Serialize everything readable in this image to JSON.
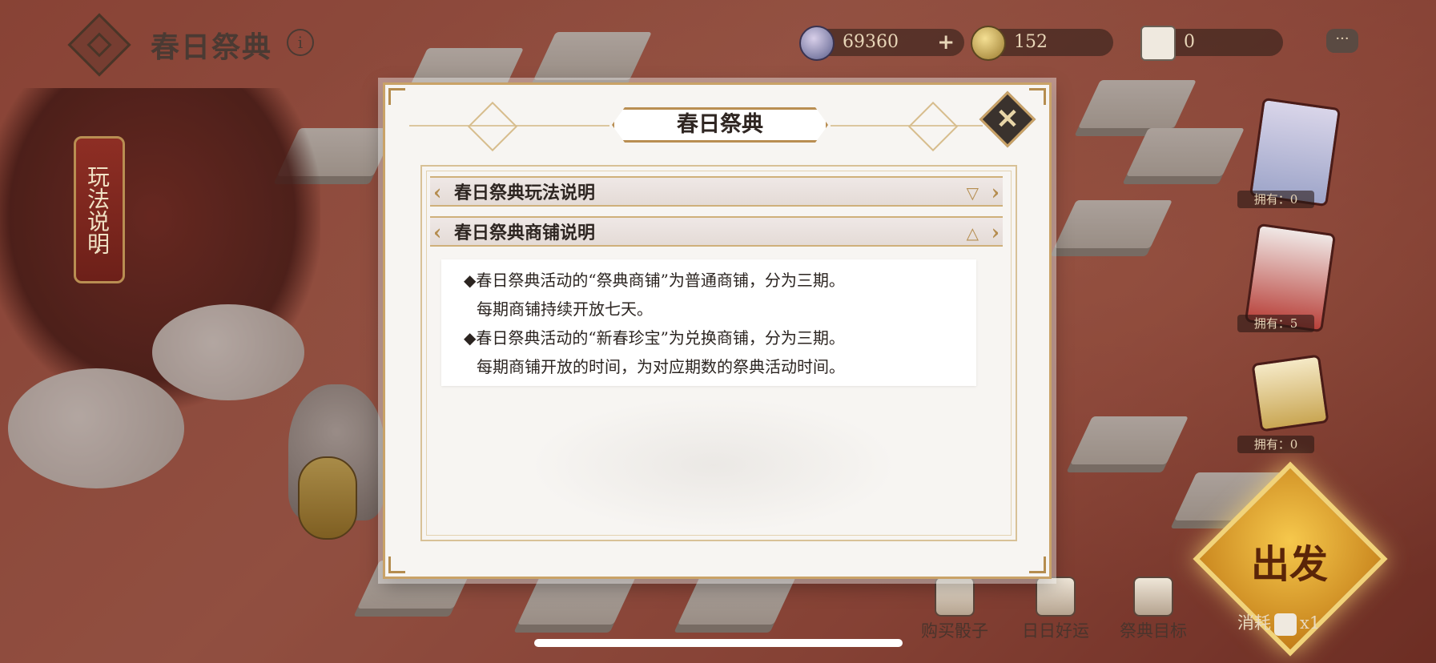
{
  "hud": {
    "title": "春日祭典",
    "info_glyph": "i",
    "gems": "69360",
    "gems_plus": "+",
    "coins": "152",
    "dice": "0",
    "chat_glyph": "···"
  },
  "side_tab": {
    "label": "玩法说明",
    "arrow": "›"
  },
  "owned_items": [
    {
      "label": "拥有：0"
    },
    {
      "label": "拥有：5"
    },
    {
      "label": "拥有：0"
    }
  ],
  "bottom": {
    "buy_dice": "购买骰子",
    "daily_luck": "日日好运",
    "festival_goal": "祭典目标",
    "go": "出发",
    "consume_label": "消耗",
    "consume_count": "x1"
  },
  "modal": {
    "title": "春日祭典",
    "close_glyph": "✕",
    "sections": [
      {
        "title": "春日祭典玩法说明",
        "toggle": "▽",
        "expanded": false
      },
      {
        "title": "春日祭典商铺说明",
        "toggle": "△",
        "expanded": true
      }
    ],
    "shop_text": [
      "◆春日祭典活动的“祭典商铺”为普通商铺，分为三期。",
      "每期商铺持续开放七天。",
      "◆春日祭典活动的“新春珍宝”为兑换商铺，分为三期。",
      "每期商铺开放的时间，为对应期数的祭典活动时间。"
    ]
  },
  "colors": {
    "accent_gold": "#c9a267",
    "panel_bg": "#f7f5f2",
    "board_red": "#b65a48"
  },
  "icons": [
    "back-diamond-icon",
    "info-icon",
    "gem-icon",
    "coin-icon",
    "dice-icon",
    "chat-icon",
    "close-icon",
    "expand-icon",
    "collapse-icon"
  ]
}
